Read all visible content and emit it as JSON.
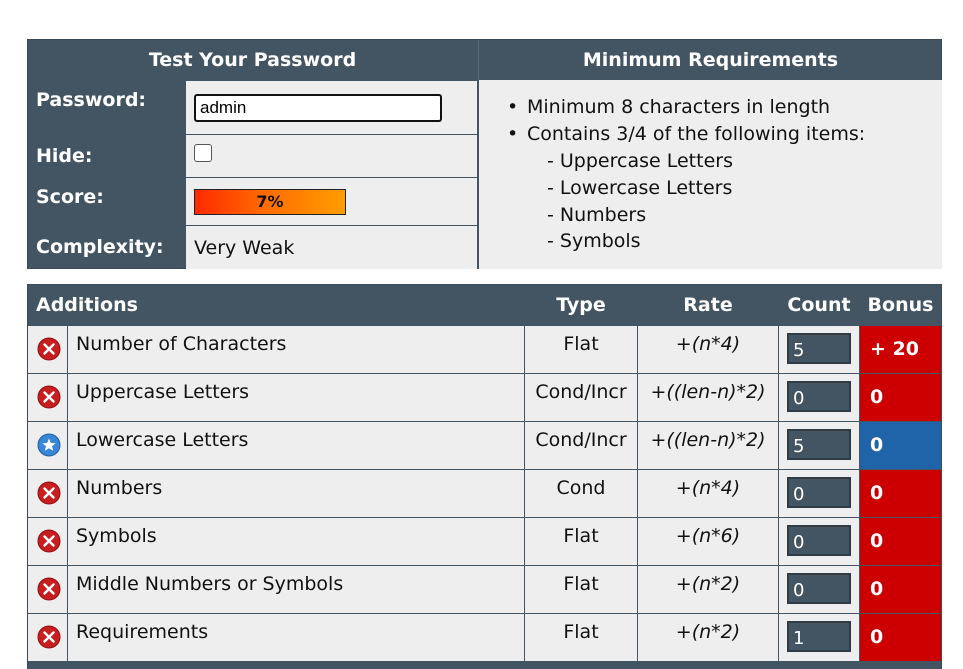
{
  "test_panel": {
    "header": "Test Your Password",
    "password_label": "Password:",
    "password_value": "admin",
    "hide_label": "Hide:",
    "score_label": "Score:",
    "score_text": "7%",
    "score_fraction": 0.07,
    "complexity_label": "Complexity:",
    "complexity_value": "Very Weak"
  },
  "requirements": {
    "header": "Minimum Requirements",
    "bullets": [
      "Minimum 8 characters in length",
      "Contains 3/4 of the following items:"
    ],
    "subitems": [
      "- Uppercase Letters",
      "- Lowercase Letters",
      "- Numbers",
      "- Symbols"
    ]
  },
  "additions": {
    "headers": [
      "Additions",
      "Type",
      "Rate",
      "Count",
      "Bonus"
    ],
    "rows": [
      {
        "icon": "fail-icon",
        "name": "Number of Characters",
        "type": "Flat",
        "rate": "+(n*4)",
        "count": "5",
        "bonus": "+ 20",
        "bonus_color": "#cc0000"
      },
      {
        "icon": "fail-icon",
        "name": "Uppercase Letters",
        "type": "Cond/Incr",
        "rate": "+((len-n)*2)",
        "count": "0",
        "bonus": "0",
        "bonus_color": "#cc0000"
      },
      {
        "icon": "exceed-icon",
        "name": "Lowercase Letters",
        "type": "Cond/Incr",
        "rate": "+((len-n)*2)",
        "count": "5",
        "bonus": "0",
        "bonus_color": "#1f63a8"
      },
      {
        "icon": "fail-icon",
        "name": "Numbers",
        "type": "Cond",
        "rate": "+(n*4)",
        "count": "0",
        "bonus": "0",
        "bonus_color": "#cc0000"
      },
      {
        "icon": "fail-icon",
        "name": "Symbols",
        "type": "Flat",
        "rate": "+(n*6)",
        "count": "0",
        "bonus": "0",
        "bonus_color": "#cc0000"
      },
      {
        "icon": "fail-icon",
        "name": "Middle Numbers or Symbols",
        "type": "Flat",
        "rate": "+(n*2)",
        "count": "0",
        "bonus": "0",
        "bonus_color": "#cc0000"
      },
      {
        "icon": "fail-icon",
        "name": "Requirements",
        "type": "Flat",
        "rate": "+(n*2)",
        "count": "1",
        "bonus": "0",
        "bonus_color": "#cc0000"
      }
    ]
  },
  "colors": {
    "header_bg": "#435563",
    "cell_bg": "#eeeeee",
    "fail": "#cc0000",
    "exceed": "#1f63a8"
  }
}
